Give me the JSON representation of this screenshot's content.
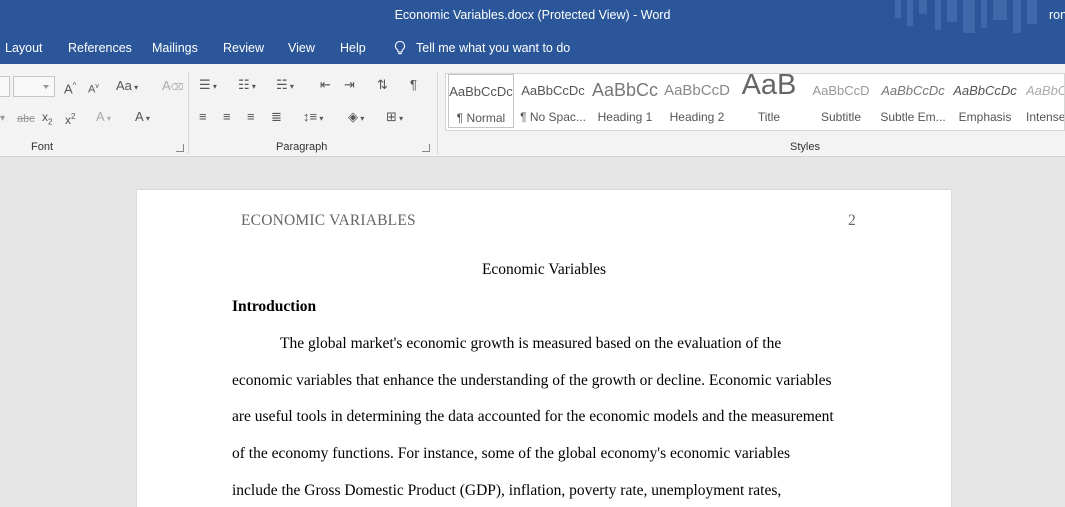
{
  "window": {
    "title": "Economic Variables.docx (Protected View)  -  Word",
    "user_initials": "ron"
  },
  "menu": {
    "tabs": [
      "Layout",
      "References",
      "Mailings",
      "Review",
      "View",
      "Help"
    ],
    "tell_me": "Tell me what you want to do"
  },
  "ribbon": {
    "groups": {
      "font": "Font",
      "paragraph": "Paragraph",
      "styles": "Styles"
    },
    "styles_gallery": [
      {
        "sample": "AaBbCcDc",
        "name": "¶ Normal"
      },
      {
        "sample": "AaBbCcDc",
        "name": "¶ No Spac..."
      },
      {
        "sample": "AaBbCc",
        "name": "Heading 1"
      },
      {
        "sample": "AaBbCcD",
        "name": "Heading 2"
      },
      {
        "sample": "AaB",
        "name": "Title"
      },
      {
        "sample": "AaBbCcD",
        "name": "Subtitle"
      },
      {
        "sample": "AaBbCcDc",
        "name": "Subtle Em..."
      },
      {
        "sample": "AaBbCcDc",
        "name": "Emphasis"
      },
      {
        "sample": "AaBbCc",
        "name": "Intense"
      }
    ]
  },
  "document": {
    "running_head": "ECONOMIC VARIABLES",
    "page_number": "2",
    "title": "Economic Variables",
    "heading": "Introduction",
    "lines": [
      "The global market's economic growth is measured based on the evaluation of the",
      "economic variables that enhance the understanding of the growth or decline. Economic variables",
      "are useful tools in determining the data accounted for the economic models and the measurement",
      "of the economy functions. For instance, some of the global economy's economic variables",
      "include the Gross Domestic Product (GDP), inflation, poverty rate, unemployment rates,"
    ]
  },
  "colors": {
    "brand": "#2b579a",
    "ribbon": "#f3f3f3",
    "canvas": "#e6e6e6"
  }
}
